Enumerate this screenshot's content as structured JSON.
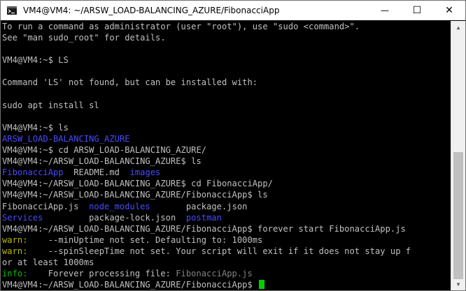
{
  "window": {
    "title": "VM4@VM4: ~/ARSW_LOAD-BALANCING_AZURE/FibonacciApp",
    "minimize_glyph": "—",
    "maximize_glyph": "☐",
    "close_glyph": "✕"
  },
  "terminal": {
    "l01": "To run a command as administrator (user \"root\"), use \"sudo <command>\".",
    "l02": "See \"man sudo_root\" for details.",
    "l03": "",
    "l04": "VM4@VM4:~$ LS",
    "l05": "",
    "l06": "Command 'LS' not found, but can be installed with:",
    "l07": "",
    "l08": "sudo apt install sl",
    "l09": "",
    "l10": "VM4@VM4:~$ ls",
    "l11": "ARSW_LOAD-BALANCING_AZURE",
    "l12": "VM4@VM4:~$ cd ARSW_LOAD-BALANCING_AZURE/",
    "l13": "VM4@VM4:~/ARSW_LOAD-BALANCING_AZURE$ ls",
    "l14_a": "FibonacciApp",
    "l14_b": "  README.md  ",
    "l14_c": "images",
    "l15": "VM4@VM4:~/ARSW_LOAD-BALANCING_AZURE$ cd FibonacciApp/",
    "l16": "VM4@VM4:~/ARSW_LOAD-BALANCING_AZURE/FibonacciApp$ ls",
    "l17_a": "FibonacciApp.js  ",
    "l17_b": "node_modules",
    "l17_c": "       package.json",
    "l18_a": "Services",
    "l18_b": "         package-lock.json  ",
    "l18_c": "postman",
    "l19": "VM4@VM4:~/ARSW_LOAD-BALANCING_AZURE/FibonacciApp$ forever start FibonacciApp.js",
    "l20_a": "warn:",
    "l20_b": "    --minUptime not set. Defaulting to: 1000ms",
    "l21_a": "warn:",
    "l21_b": "    --spinSleepTime not set. Your script will exit if it does not stay up f",
    "l22": "or at least 1000ms",
    "l23_a": "info:",
    "l23_b": "    Forever processing file: ",
    "l23_c": "FibonacciApp.js",
    "l24": "VM4@VM4:~/ARSW_LOAD-BALANCING_AZURE/FibonacciApp$ "
  },
  "colors": {
    "terminal_bg": "#000000",
    "text": "#c0c0c0",
    "directory": "#4a4aff",
    "cursor": "#00d000",
    "warn": "#b8b800",
    "info": "#00c000"
  }
}
